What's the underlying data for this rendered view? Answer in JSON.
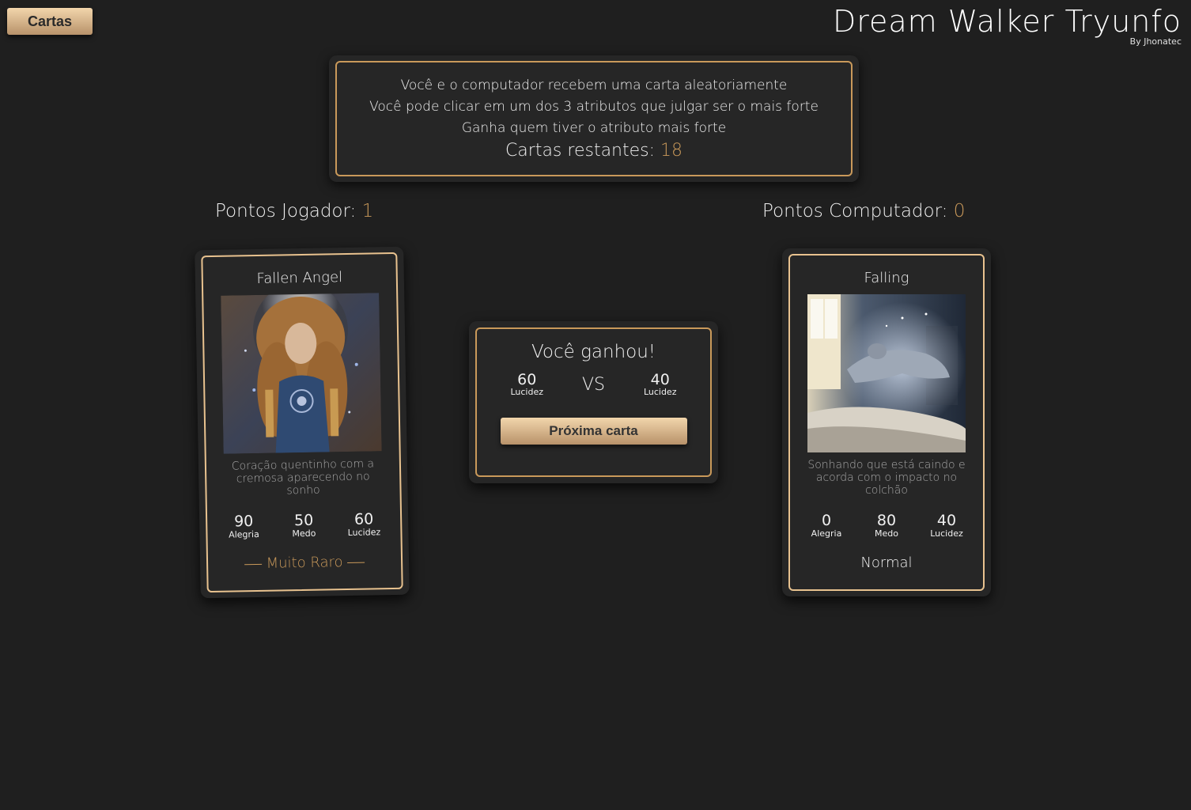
{
  "header": {
    "cards_button": "Cartas",
    "title": "Dream Walker Tryunfo",
    "subtitle": "By Jhonatec"
  },
  "rules": {
    "line1": "Você e o computador recebem uma carta aleatoriamente",
    "line2": "Você pode clicar em um dos 3 atributos que julgar ser o mais forte",
    "line3": "Ganha quem tiver o atributo mais forte",
    "remaining_label": "Cartas restantes:",
    "remaining_value": "18"
  },
  "scores": {
    "player_label": "Pontos Jogador:",
    "player_value": "1",
    "cpu_label": "Pontos Computador:",
    "cpu_value": "0"
  },
  "player_card": {
    "name": "Fallen Angel",
    "image": "angel-portrait",
    "description": "Coração quentinho com a cremosa aparecendo no sonho",
    "attributes": [
      {
        "value": "90",
        "label": "Alegria"
      },
      {
        "value": "50",
        "label": "Medo"
      },
      {
        "value": "60",
        "label": "Lucidez"
      }
    ],
    "rarity": "Muito Raro"
  },
  "cpu_card": {
    "name": "Falling",
    "image": "falling-bedroom",
    "description": "Sonhando que está caindo e acorda com o impacto no colchão",
    "attributes": [
      {
        "value": "0",
        "label": "Alegria"
      },
      {
        "value": "80",
        "label": "Medo"
      },
      {
        "value": "40",
        "label": "Lucidez"
      }
    ],
    "rarity": "Normal"
  },
  "result": {
    "title": "Você ganhou!",
    "player_value": "60",
    "player_attr": "Lucidez",
    "vs": "VS",
    "cpu_value": "40",
    "cpu_attr": "Lucidez",
    "next_button": "Próxima carta"
  },
  "colors": {
    "background": "#1f1f1f",
    "accent_gold": "#c9995a",
    "panel": "#262626"
  }
}
